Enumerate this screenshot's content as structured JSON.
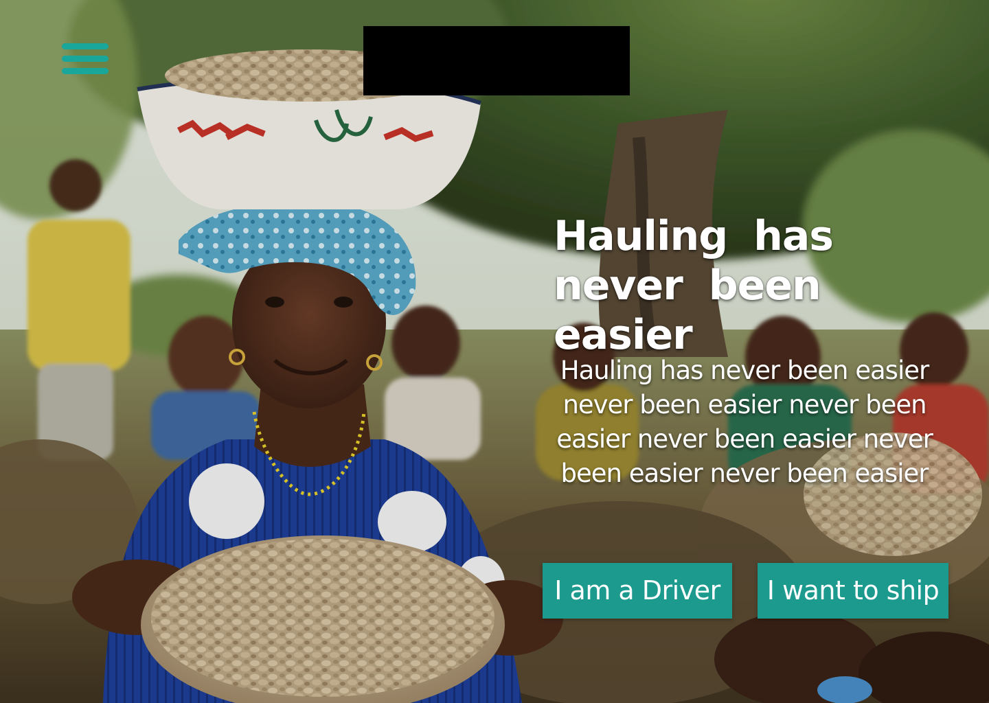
{
  "nav": {
    "menu_icon": "hamburger-menu-icon",
    "accent_color": "#1aa79b"
  },
  "logo": {
    "color": "#000000"
  },
  "hero": {
    "image": "woman-carrying-peanut-bowl-photo",
    "headline": "Hauling has never been easier",
    "subtext": "Hauling has never been easier never been easier never been easier never been easier never been easier never been easier"
  },
  "actions": {
    "driver_label": "I am a Driver",
    "ship_label": "I want to ship",
    "button_color": "#1d9a8e"
  }
}
